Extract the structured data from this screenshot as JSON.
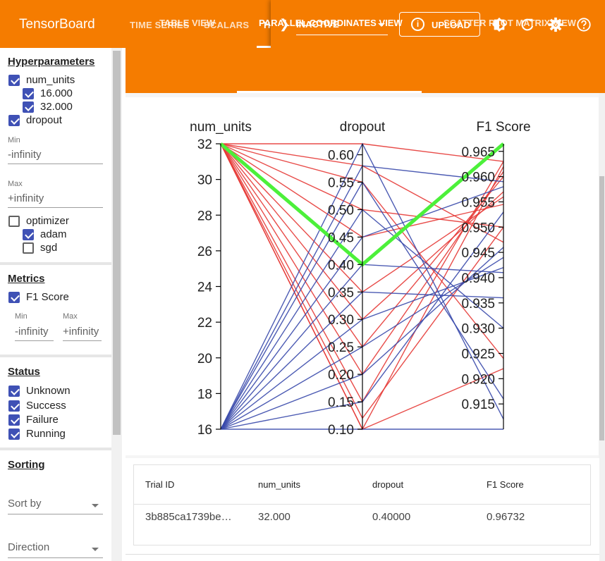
{
  "app": {
    "title": "TensorBoard"
  },
  "nav": {
    "tabs": [
      {
        "label": "TIME SERIES"
      },
      {
        "label": "SCALARS"
      },
      {
        "label": "H"
      }
    ],
    "inactive_label": "INACTIVE",
    "upload_label": "UPLOAD"
  },
  "subtabs": {
    "table": "TABLE VIEW",
    "parallel": "PARALLEL COORDINATES VIEW",
    "scatter": "SCATTER PLOT MATRIX VIEW"
  },
  "sidebar": {
    "hparams_title": "Hyperparameters",
    "num_units": {
      "label": "num_units",
      "values": [
        "16.000",
        "32.000"
      ]
    },
    "dropout": {
      "label": "dropout",
      "min_label": "Min",
      "min_value": "-infinity",
      "max_label": "Max",
      "max_value": "+infinity"
    },
    "optimizer": {
      "label": "optimizer",
      "values": [
        "adam",
        "sgd"
      ]
    },
    "metrics_title": "Metrics",
    "f1": {
      "label": "F1 Score",
      "min_label": "Min",
      "min_value": "-infinity",
      "max_label": "Max",
      "max_value": "+infinity"
    },
    "status_title": "Status",
    "status_items": [
      "Unknown",
      "Success",
      "Failure",
      "Running"
    ],
    "sorting_title": "Sorting",
    "sort_by": "Sort by",
    "direction": "Direction"
  },
  "colors": {
    "accent": "#f57c00",
    "checkbox": "#3f51b5",
    "high": "#e53935",
    "low": "#3949ab",
    "selected": "#4cf03a"
  },
  "chart_data": {
    "type": "parallel-coordinates",
    "axes": [
      {
        "name": "num_units",
        "range": [
          16,
          32
        ],
        "ticks": [
          "32",
          "30",
          "28",
          "26",
          "24",
          "22",
          "20",
          "18",
          "16"
        ]
      },
      {
        "name": "dropout",
        "range": [
          0.1,
          0.62
        ],
        "ticks": [
          "0.60",
          "0.55",
          "0.50",
          "0.45",
          "0.40",
          "0.35",
          "0.30",
          "0.25",
          "0.20",
          "0.15",
          "0.10"
        ]
      },
      {
        "name": "F1 Score",
        "range": [
          0.91,
          0.9665
        ],
        "ticks": [
          "0.965",
          "0.960",
          "0.955",
          "0.950",
          "0.945",
          "0.940",
          "0.935",
          "0.930",
          "0.925",
          "0.920",
          "0.915"
        ]
      }
    ],
    "trials": [
      {
        "values": [
          32,
          0.4,
          0.9665
        ],
        "color": "selected"
      },
      {
        "values": [
          32,
          0.1,
          0.962
        ],
        "color": "high"
      },
      {
        "values": [
          32,
          0.15,
          0.963
        ],
        "color": "high"
      },
      {
        "values": [
          32,
          0.2,
          0.961
        ],
        "color": "high"
      },
      {
        "values": [
          32,
          0.25,
          0.96
        ],
        "color": "high"
      },
      {
        "values": [
          32,
          0.3,
          0.957
        ],
        "color": "high"
      },
      {
        "values": [
          32,
          0.35,
          0.956
        ],
        "color": "high"
      },
      {
        "values": [
          32,
          0.45,
          0.9545
        ],
        "color": "high"
      },
      {
        "values": [
          32,
          0.5,
          0.95
        ],
        "color": "high"
      },
      {
        "values": [
          32,
          0.55,
          0.924
        ],
        "color": "high"
      },
      {
        "values": [
          32,
          0.58,
          0.947
        ],
        "color": "high"
      },
      {
        "values": [
          32,
          0.62,
          0.963
        ],
        "color": "high"
      },
      {
        "values": [
          32,
          0.1,
          0.922
        ],
        "color": "high"
      },
      {
        "values": [
          32,
          0.12,
          0.95
        ],
        "color": "high"
      },
      {
        "values": [
          16,
          0.1,
          0.91
        ],
        "color": "low"
      },
      {
        "values": [
          16,
          0.15,
          0.953
        ],
        "color": "low"
      },
      {
        "values": [
          16,
          0.2,
          0.946
        ],
        "color": "low"
      },
      {
        "values": [
          16,
          0.25,
          0.944
        ],
        "color": "low"
      },
      {
        "values": [
          16,
          0.3,
          0.942
        ],
        "color": "low"
      },
      {
        "values": [
          16,
          0.35,
          0.936
        ],
        "color": "low"
      },
      {
        "values": [
          16,
          0.4,
          0.941
        ],
        "color": "low"
      },
      {
        "values": [
          16,
          0.45,
          0.958
        ],
        "color": "low"
      },
      {
        "values": [
          16,
          0.5,
          0.93
        ],
        "color": "low"
      },
      {
        "values": [
          16,
          0.55,
          0.916
        ],
        "color": "low"
      },
      {
        "values": [
          16,
          0.58,
          0.959
        ],
        "color": "low"
      },
      {
        "values": [
          16,
          0.62,
          0.912
        ],
        "color": "low"
      }
    ]
  },
  "table": {
    "headers": [
      "Trial ID",
      "num_units",
      "dropout",
      "F1 Score"
    ],
    "row": [
      "3b885ca1739be…",
      "32.000",
      "0.40000",
      "0.96732"
    ]
  }
}
